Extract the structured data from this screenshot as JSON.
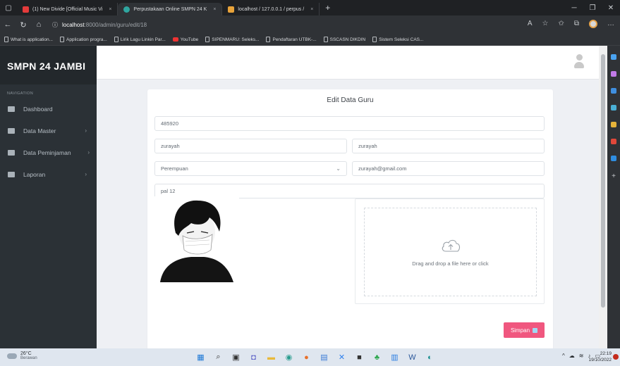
{
  "browser": {
    "tabs": [
      {
        "label": "(1) New Divide [Official Music Vi",
        "icon_color": "#e33b3b"
      },
      {
        "label": "Perpustakaan Online SMPN 24 K",
        "icon_color": "#2fa6a0"
      },
      {
        "label": "localhost / 127.0.0.1 / perpus / ",
        "icon_color": "#e8a33a"
      }
    ],
    "tab_close": "×",
    "new_tab": "+",
    "url_host": "localhost",
    "url_path": ":8000/admin/guru/edit/18",
    "bookmarks": [
      "What is application...",
      "Application progra...",
      "Lirik Lagu Linkin Par...",
      "YouTube",
      "SIPENMARU: Seleks...",
      "Pendaftaran UTBK-...",
      "SSCASN DIKDIN",
      "Sistem Seleksi CAS..."
    ]
  },
  "sidebar": {
    "brand": "SMPN 24 JAMBI",
    "section_label": "NAVIGATION",
    "items": [
      {
        "label": "Dashboard",
        "has_caret": false
      },
      {
        "label": "Data Master",
        "has_caret": true
      },
      {
        "label": "Data Peminjaman",
        "has_caret": true
      },
      {
        "label": "Laporan",
        "has_caret": true
      }
    ]
  },
  "form": {
    "title": "Edit Data Guru",
    "nip": "485920",
    "nama": "zurayah",
    "username": "zurayah",
    "jenis_kelamin": "Perempuan",
    "email": "zurayah@gmail.com",
    "alamat": "pal 12",
    "dropzone_text": "Drag and drop a file here or click",
    "save_label": "Simpan"
  },
  "taskbar": {
    "temperature": "26°C",
    "weather": "Berawan",
    "time": "22:19",
    "date": "19/10/2022"
  },
  "colors": {
    "sidebar_bg": "#2b3136",
    "brand_bg": "#23282c",
    "save_button": "#f0577f",
    "page_bg": "#eef0f4"
  }
}
